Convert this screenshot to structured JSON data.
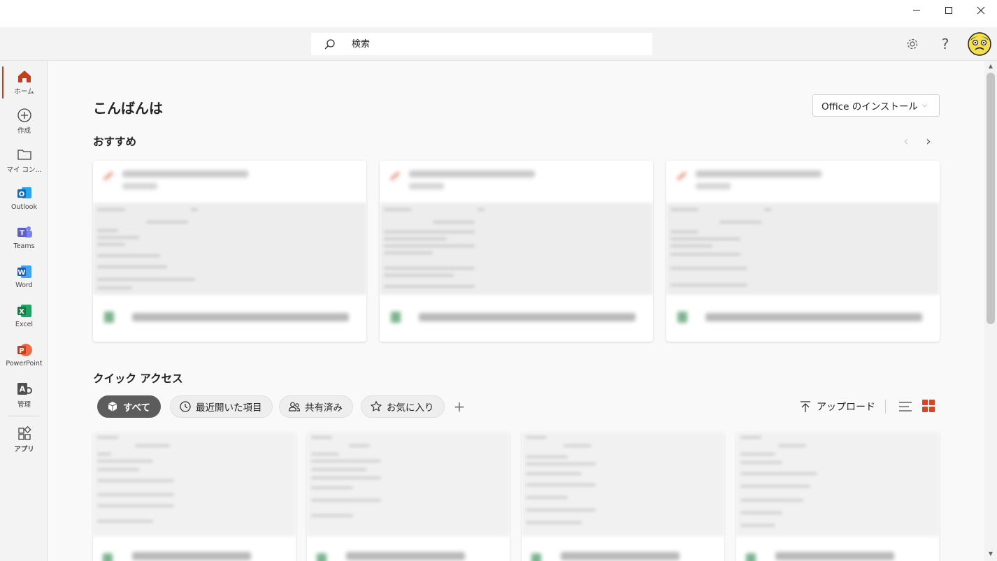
{
  "window": {
    "minimize_glyph": "─",
    "maximize_glyph": "□",
    "close_glyph": "✕"
  },
  "header": {
    "search_placeholder": "検索",
    "help_glyph": "?"
  },
  "rail": {
    "items": [
      {
        "label": "ホーム",
        "icon": "home-icon"
      },
      {
        "label": "作成",
        "icon": "plus-circle-icon"
      },
      {
        "label": "マイ コン...",
        "icon": "folder-icon"
      },
      {
        "label": "Outlook",
        "icon": "outlook-icon"
      },
      {
        "label": "Teams",
        "icon": "teams-icon"
      },
      {
        "label": "Word",
        "icon": "word-icon"
      },
      {
        "label": "Excel",
        "icon": "excel-icon"
      },
      {
        "label": "PowerPoint",
        "icon": "powerpoint-icon"
      },
      {
        "label": "管理",
        "icon": "admin-icon"
      },
      {
        "label": "アプリ",
        "icon": "apps-icon"
      }
    ],
    "letters": {
      "outlook": "O",
      "teams": "T",
      "word": "W",
      "excel": "X",
      "powerpoint": "P",
      "admin": "A"
    }
  },
  "main": {
    "greeting": "こんばんは",
    "install_button": "Office のインストール",
    "install_chevron": "⌵",
    "recommended_title": "おすすめ",
    "prev_glyph": "‹",
    "next_glyph": "›",
    "quick_access_title": "クイック アクセス",
    "filters": [
      {
        "label": "すべて",
        "icon": "cube-icon",
        "active": true
      },
      {
        "label": "最近開いた項目",
        "icon": "clock-icon",
        "active": false
      },
      {
        "label": "共有済み",
        "icon": "people-icon",
        "active": false
      },
      {
        "label": "お気に入り",
        "icon": "star-icon",
        "active": false
      }
    ],
    "add_filter_glyph": "+",
    "upload_label": "アップロード"
  },
  "colors": {
    "accent": "#c43e1c",
    "grid_view": "#d24726",
    "outlook": "#0f6cbd",
    "teams": "#5b5fc7",
    "word": "#185abd",
    "excel": "#107c41",
    "powerpoint": "#c43e1c",
    "admin": "#505050"
  }
}
